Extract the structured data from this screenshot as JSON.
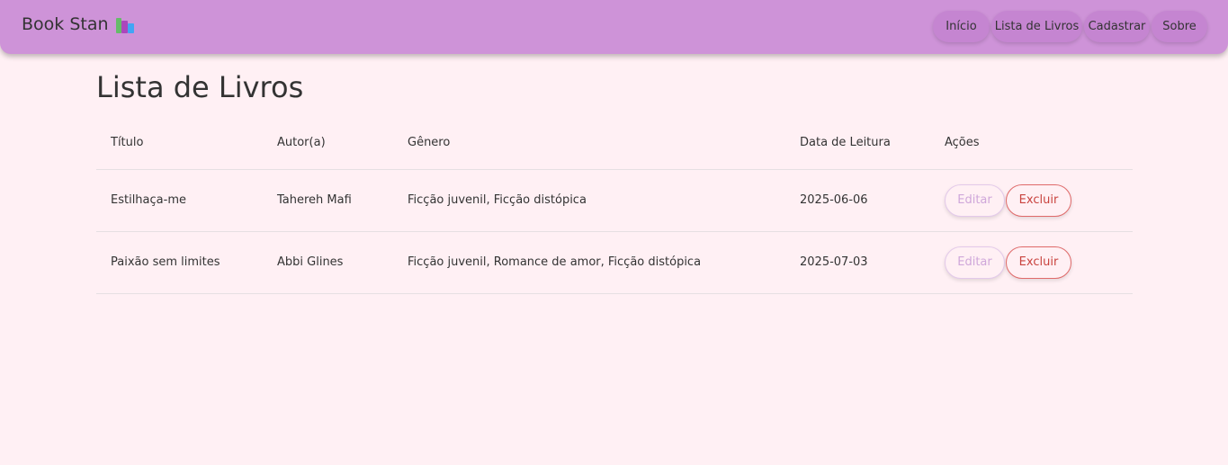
{
  "navbar": {
    "brand": "Book Stan",
    "brand_icon": "books-icon",
    "links": [
      {
        "label": "Início"
      },
      {
        "label": "Lista de Livros"
      },
      {
        "label": "Cadastrar"
      },
      {
        "label": "Sobre"
      }
    ]
  },
  "colors": {
    "navbar_bg": "#ce93d8",
    "page_bg": "#fff0f4",
    "edit_text": "#cfa7da",
    "delete_text": "#c9433f"
  },
  "page": {
    "title": "Lista de Livros"
  },
  "table": {
    "headers": [
      "Título",
      "Autor(a)",
      "Gênero",
      "Data de Leitura",
      "Ações"
    ],
    "rows": [
      {
        "titulo": "Estilhaça-me",
        "autor": "Tahereh Mafi",
        "genero": "Ficção juvenil, Ficção distópica",
        "data": "2025-06-06",
        "edit_label": "Editar",
        "delete_label": "Excluir"
      },
      {
        "titulo": "Paixão sem limites",
        "autor": "Abbi Glines",
        "genero": "Ficção juvenil, Romance de amor, Ficção distópica",
        "data": "2025-07-03",
        "edit_label": "Editar",
        "delete_label": "Excluir"
      }
    ]
  }
}
